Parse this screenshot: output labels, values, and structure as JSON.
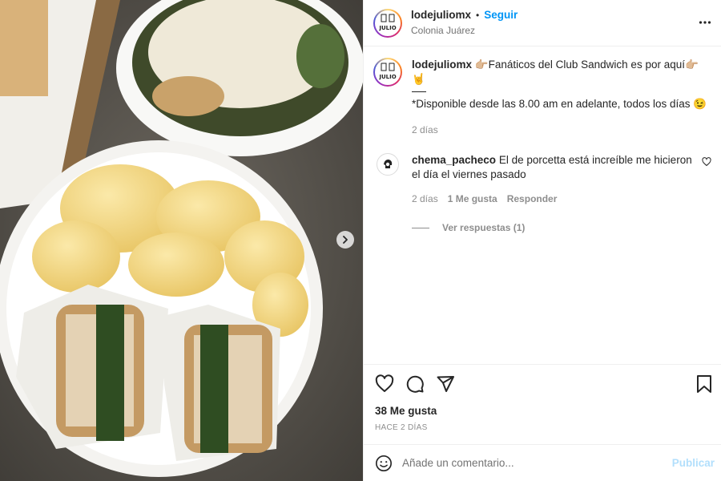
{
  "post": {
    "username": "lodejuliomx",
    "dot": "•",
    "follow_label": "Seguir",
    "location": "Colonia Juárez",
    "avatar_text": "JULIO"
  },
  "caption": {
    "username": "lodejuliomx",
    "line1": "👉🏼Fanáticos del Club Sandwich es por aquí👉🏼🤘",
    "line2": "*Disponible desde las 8.00 am en adelante, todos los días 😉",
    "age": "2 días"
  },
  "comment": {
    "username": "chema_pacheco",
    "text": "El de porcetta está increíble me hicieron el día el viernes pasado",
    "age": "2 días",
    "likes": "1 Me gusta",
    "reply_label": "Responder",
    "view_replies": "Ver respuestas (1)"
  },
  "actions": {
    "likes": "38 Me gusta",
    "time": "HACE 2 DÍAS"
  },
  "composer": {
    "placeholder": "Añade un comentario...",
    "publish_label": "Publicar"
  },
  "colors": {
    "link": "#0095f6",
    "publish_disabled": "#b2dffc",
    "meta": "#8e8e8e"
  }
}
